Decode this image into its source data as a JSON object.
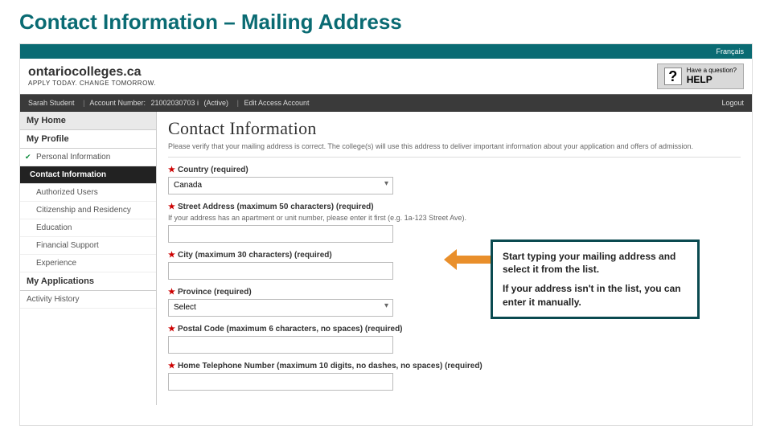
{
  "slide": {
    "title": "Contact Information – Mailing Address"
  },
  "topbar": {
    "lang": "Français"
  },
  "brand": {
    "name": "ontariocolleges.ca",
    "tagline": "APPLY TODAY. CHANGE TOMORROW."
  },
  "help": {
    "small": "Have a question?",
    "big": "HELP",
    "icon": "?"
  },
  "account": {
    "user": "Sarah Student",
    "acct_label": "Account Number:",
    "acct_num": "21002030703 i",
    "status": "(Active)",
    "edit": "Edit Access Account",
    "logout": "Logout"
  },
  "sidebar": {
    "home": "My Home",
    "profile": "My Profile",
    "items": [
      "Personal Information",
      "Contact Information",
      "Authorized Users",
      "Citizenship and Residency",
      "Education",
      "Financial Support",
      "Experience"
    ],
    "apps": "My Applications",
    "activity": "Activity History"
  },
  "main": {
    "heading": "Contact Information",
    "intro": "Please verify that your mailing address is correct. The college(s) will use this address to deliver important information about your application and offers of admission.",
    "fields": {
      "country": {
        "label": "Country (required)",
        "value": "Canada"
      },
      "street": {
        "label": "Street Address (maximum 50 characters) (required)",
        "hint": "If your address has an apartment or unit number, please enter it first (e.g. 1a-123 Street Ave)."
      },
      "city": {
        "label": "City (maximum 30 characters) (required)"
      },
      "province": {
        "label": "Province (required)",
        "value": "Select"
      },
      "postal": {
        "label": "Postal Code (maximum 6 characters, no spaces) (required)"
      },
      "phone": {
        "label": "Home Telephone Number (maximum 10 digits, no dashes, no spaces) (required)"
      }
    }
  },
  "callout": {
    "line1": "Start typing your mailing address and select it from the list.",
    "line2": "If your address isn't in the list, you can enter it manually."
  }
}
